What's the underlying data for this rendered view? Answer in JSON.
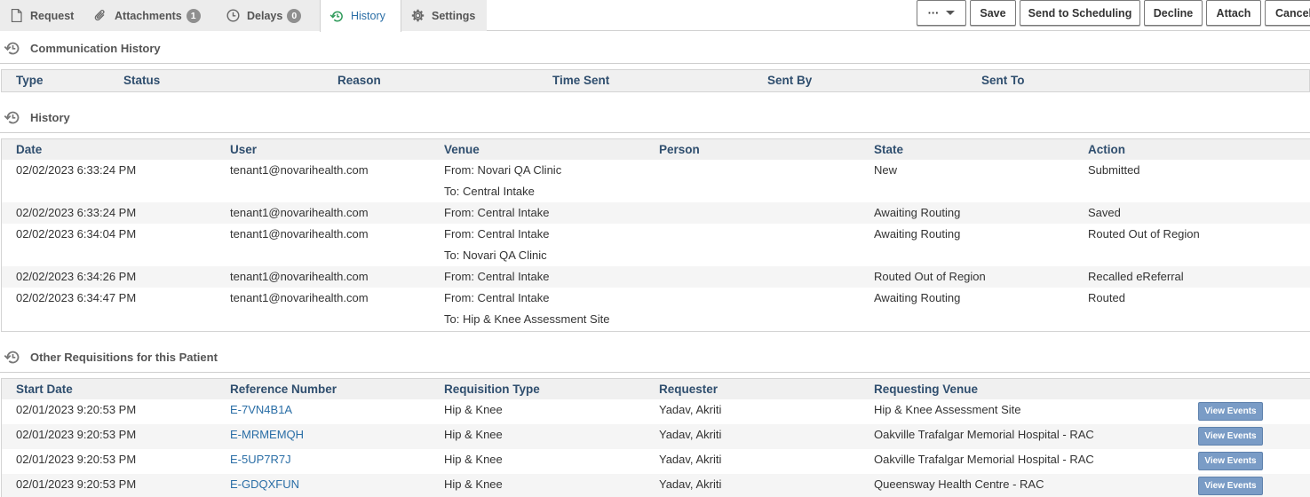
{
  "tabs": [
    {
      "label": "Request",
      "icon": "file-icon"
    },
    {
      "label": "Attachments",
      "icon": "paperclip-icon",
      "count": "1"
    },
    {
      "label": "Delays",
      "icon": "clock-icon",
      "count": "0"
    },
    {
      "label": "History",
      "icon": "history-icon",
      "active": true
    },
    {
      "label": "Settings",
      "icon": "gear-icon"
    }
  ],
  "toolbar": {
    "more_label": "···",
    "save_label": "Save",
    "send_label": "Send to Scheduling",
    "decline_label": "Decline",
    "attach_label": "Attach",
    "cancel_label": "Cancel"
  },
  "comm_history": {
    "title": "Communication History",
    "columns": [
      "Type",
      "Status",
      "Reason",
      "Time Sent",
      "Sent By",
      "Sent To"
    ]
  },
  "history": {
    "title": "History",
    "columns": [
      "Date",
      "User",
      "Venue",
      "Person",
      "State",
      "Action"
    ],
    "rows": [
      {
        "date": "02/02/2023 6:33:24 PM",
        "user": "tenant1@novarihealth.com",
        "venue1": "From: Novari QA Clinic",
        "venue2": "To: Central Intake",
        "person": "",
        "state": "New",
        "action": "Submitted"
      },
      {
        "date": "02/02/2023 6:33:24 PM",
        "user": "tenant1@novarihealth.com",
        "venue1": "From: Central Intake",
        "venue2": "",
        "person": "",
        "state": "Awaiting Routing",
        "action": "Saved"
      },
      {
        "date": "02/02/2023 6:34:04 PM",
        "user": "tenant1@novarihealth.com",
        "venue1": "From: Central Intake",
        "venue2": "To: Novari QA Clinic",
        "person": "",
        "state": "Awaiting Routing",
        "action": "Routed Out of Region"
      },
      {
        "date": "02/02/2023 6:34:26 PM",
        "user": "tenant1@novarihealth.com",
        "venue1": "From: Central Intake",
        "venue2": "",
        "person": "",
        "state": "Routed Out of Region",
        "action": "Recalled eReferral"
      },
      {
        "date": "02/02/2023 6:34:47 PM",
        "user": "tenant1@novarihealth.com",
        "venue1": "From: Central Intake",
        "venue2": "To: Hip & Knee Assessment Site",
        "person": "",
        "state": "Awaiting Routing",
        "action": "Routed"
      }
    ]
  },
  "other_reqs": {
    "title": "Other Requisitions for this Patient",
    "columns": [
      "Start Date",
      "Reference Number",
      "Requisition Type",
      "Requester",
      "Requesting Venue"
    ],
    "view_label": "View Events",
    "rows": [
      {
        "start": "02/01/2023 9:20:53 PM",
        "ref": "E-7VN4B1A",
        "type": "Hip & Knee",
        "requester": "Yadav, Akriti",
        "venue": "Hip & Knee Assessment Site"
      },
      {
        "start": "02/01/2023 9:20:53 PM",
        "ref": "E-MRMEMQH",
        "type": "Hip & Knee",
        "requester": "Yadav, Akriti",
        "venue": "Oakville Trafalgar Memorial Hospital - RAC"
      },
      {
        "start": "02/01/2023 9:20:53 PM",
        "ref": "E-5UP7R7J",
        "type": "Hip & Knee",
        "requester": "Yadav, Akriti",
        "venue": "Oakville Trafalgar Memorial Hospital - RAC"
      },
      {
        "start": "02/01/2023 9:20:53 PM",
        "ref": "E-GDQXFUN",
        "type": "Hip & Knee",
        "requester": "Yadav, Akriti",
        "venue": "Queensway Health Centre - RAC"
      }
    ]
  }
}
